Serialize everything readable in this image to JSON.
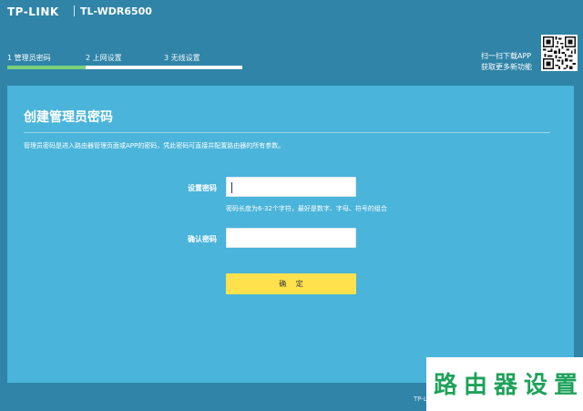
{
  "header": {
    "brand": "TP-LINK",
    "model": "TL-WDR6500"
  },
  "steps": [
    {
      "label": "1 管理员密码",
      "active": true
    },
    {
      "label": "2 上网设置",
      "active": false
    },
    {
      "label": "3 无线设置",
      "active": false
    }
  ],
  "app_promo": {
    "line1": "扫一扫下载APP",
    "line2": "获取更多新功能"
  },
  "panel": {
    "title": "创建管理员密码",
    "description": "管理员密码是进入路由器管理页面或APP的密码，凭此密码可直接并配置路由器的所有参数。",
    "set_password_label": "设置密码",
    "set_password_value": "",
    "password_hint": "密码长度为6-32个字符，最好是数字、字母、符号的组合",
    "confirm_password_label": "确认密码",
    "confirm_password_value": "",
    "confirm_button": "确 定"
  },
  "footer": {
    "text": "TP-L"
  },
  "watermark": {
    "text": "路由器设置"
  },
  "colors": {
    "background": "#2f84a8",
    "panel": "#4ab4da",
    "active_step": "#7bd07b",
    "button": "#ffe14e",
    "watermark_text": "#1ea25a"
  },
  "icons": {
    "qr": "qr-code-icon"
  }
}
